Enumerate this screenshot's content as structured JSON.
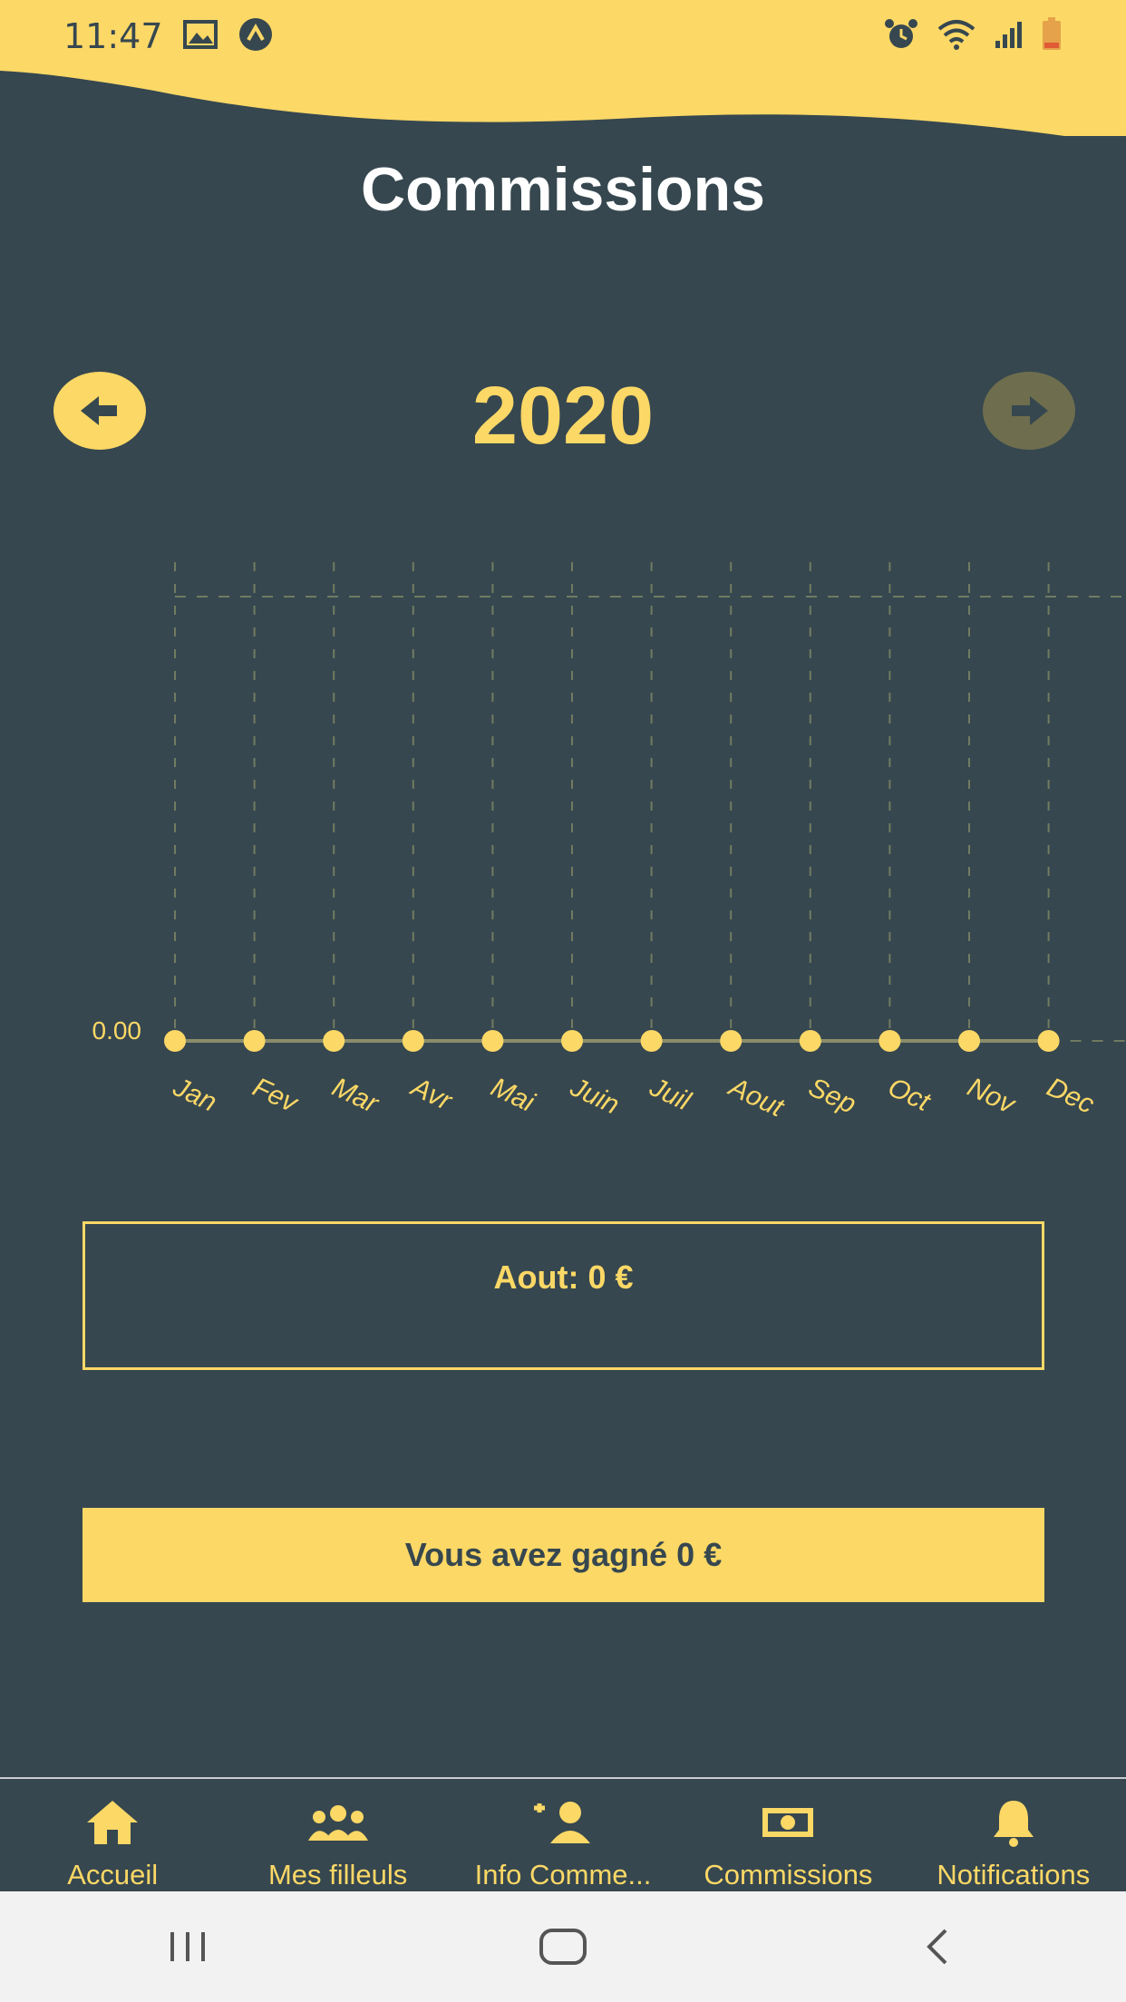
{
  "status_bar": {
    "time": "11:47",
    "icons": [
      "image-icon",
      "app-notification-icon",
      "alarm-icon",
      "wifi-icon",
      "signal-icon",
      "battery-icon"
    ]
  },
  "header": {
    "title": "Commissions"
  },
  "year_nav": {
    "year": "2020",
    "prev_icon": "arrow-left-icon",
    "next_icon": "arrow-right-icon",
    "next_enabled": false
  },
  "chart_data": {
    "type": "line",
    "categories": [
      "Jan",
      "Fev",
      "Mar",
      "Avr",
      "Mai",
      "Juin",
      "Juil",
      "Aout",
      "Sep",
      "Oct",
      "Nov",
      "Dec"
    ],
    "series": [
      {
        "values": [
          0,
          0,
          0,
          0,
          0,
          0,
          0,
          0,
          0,
          0,
          0,
          0
        ]
      }
    ],
    "y_tick_labels": [
      "0.00"
    ],
    "grid": true,
    "color": "#FCD866"
  },
  "selected_month": {
    "text": "Aout: 0 €"
  },
  "earnings": {
    "text": "Vous avez gagné 0 €"
  },
  "bottom_nav": {
    "items": [
      {
        "label": "Accueil",
        "icon": "home-icon"
      },
      {
        "label": "Mes filleuls",
        "icon": "users-icon"
      },
      {
        "label": "Info Comme...",
        "icon": "add-user-icon"
      },
      {
        "label": "Commissions",
        "icon": "money-icon"
      },
      {
        "label": "Notifications",
        "icon": "bell-icon"
      }
    ]
  },
  "system_nav": {
    "icons": [
      "recent-apps-icon",
      "home-button-icon",
      "back-icon"
    ]
  },
  "colors": {
    "background": "#36474F",
    "accent": "#FCD866",
    "title": "#FFFFFF"
  }
}
